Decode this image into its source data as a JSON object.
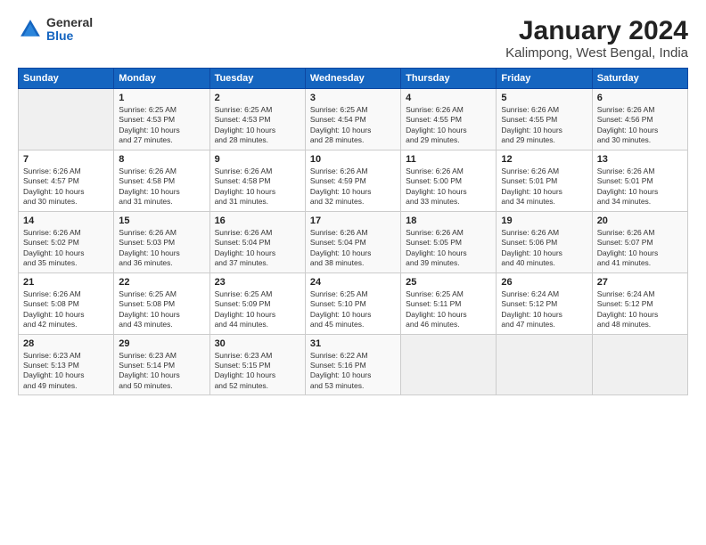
{
  "logo": {
    "general": "General",
    "blue": "Blue"
  },
  "title": "January 2024",
  "subtitle": "Kalimpong, West Bengal, India",
  "days_header": [
    "Sunday",
    "Monday",
    "Tuesday",
    "Wednesday",
    "Thursday",
    "Friday",
    "Saturday"
  ],
  "weeks": [
    [
      {
        "num": "",
        "info": ""
      },
      {
        "num": "1",
        "info": "Sunrise: 6:25 AM\nSunset: 4:53 PM\nDaylight: 10 hours\nand 27 minutes."
      },
      {
        "num": "2",
        "info": "Sunrise: 6:25 AM\nSunset: 4:53 PM\nDaylight: 10 hours\nand 28 minutes."
      },
      {
        "num": "3",
        "info": "Sunrise: 6:25 AM\nSunset: 4:54 PM\nDaylight: 10 hours\nand 28 minutes."
      },
      {
        "num": "4",
        "info": "Sunrise: 6:26 AM\nSunset: 4:55 PM\nDaylight: 10 hours\nand 29 minutes."
      },
      {
        "num": "5",
        "info": "Sunrise: 6:26 AM\nSunset: 4:55 PM\nDaylight: 10 hours\nand 29 minutes."
      },
      {
        "num": "6",
        "info": "Sunrise: 6:26 AM\nSunset: 4:56 PM\nDaylight: 10 hours\nand 30 minutes."
      }
    ],
    [
      {
        "num": "7",
        "info": "Sunrise: 6:26 AM\nSunset: 4:57 PM\nDaylight: 10 hours\nand 30 minutes."
      },
      {
        "num": "8",
        "info": "Sunrise: 6:26 AM\nSunset: 4:58 PM\nDaylight: 10 hours\nand 31 minutes."
      },
      {
        "num": "9",
        "info": "Sunrise: 6:26 AM\nSunset: 4:58 PM\nDaylight: 10 hours\nand 31 minutes."
      },
      {
        "num": "10",
        "info": "Sunrise: 6:26 AM\nSunset: 4:59 PM\nDaylight: 10 hours\nand 32 minutes."
      },
      {
        "num": "11",
        "info": "Sunrise: 6:26 AM\nSunset: 5:00 PM\nDaylight: 10 hours\nand 33 minutes."
      },
      {
        "num": "12",
        "info": "Sunrise: 6:26 AM\nSunset: 5:01 PM\nDaylight: 10 hours\nand 34 minutes."
      },
      {
        "num": "13",
        "info": "Sunrise: 6:26 AM\nSunset: 5:01 PM\nDaylight: 10 hours\nand 34 minutes."
      }
    ],
    [
      {
        "num": "14",
        "info": "Sunrise: 6:26 AM\nSunset: 5:02 PM\nDaylight: 10 hours\nand 35 minutes."
      },
      {
        "num": "15",
        "info": "Sunrise: 6:26 AM\nSunset: 5:03 PM\nDaylight: 10 hours\nand 36 minutes."
      },
      {
        "num": "16",
        "info": "Sunrise: 6:26 AM\nSunset: 5:04 PM\nDaylight: 10 hours\nand 37 minutes."
      },
      {
        "num": "17",
        "info": "Sunrise: 6:26 AM\nSunset: 5:04 PM\nDaylight: 10 hours\nand 38 minutes."
      },
      {
        "num": "18",
        "info": "Sunrise: 6:26 AM\nSunset: 5:05 PM\nDaylight: 10 hours\nand 39 minutes."
      },
      {
        "num": "19",
        "info": "Sunrise: 6:26 AM\nSunset: 5:06 PM\nDaylight: 10 hours\nand 40 minutes."
      },
      {
        "num": "20",
        "info": "Sunrise: 6:26 AM\nSunset: 5:07 PM\nDaylight: 10 hours\nand 41 minutes."
      }
    ],
    [
      {
        "num": "21",
        "info": "Sunrise: 6:26 AM\nSunset: 5:08 PM\nDaylight: 10 hours\nand 42 minutes."
      },
      {
        "num": "22",
        "info": "Sunrise: 6:25 AM\nSunset: 5:08 PM\nDaylight: 10 hours\nand 43 minutes."
      },
      {
        "num": "23",
        "info": "Sunrise: 6:25 AM\nSunset: 5:09 PM\nDaylight: 10 hours\nand 44 minutes."
      },
      {
        "num": "24",
        "info": "Sunrise: 6:25 AM\nSunset: 5:10 PM\nDaylight: 10 hours\nand 45 minutes."
      },
      {
        "num": "25",
        "info": "Sunrise: 6:25 AM\nSunset: 5:11 PM\nDaylight: 10 hours\nand 46 minutes."
      },
      {
        "num": "26",
        "info": "Sunrise: 6:24 AM\nSunset: 5:12 PM\nDaylight: 10 hours\nand 47 minutes."
      },
      {
        "num": "27",
        "info": "Sunrise: 6:24 AM\nSunset: 5:12 PM\nDaylight: 10 hours\nand 48 minutes."
      }
    ],
    [
      {
        "num": "28",
        "info": "Sunrise: 6:23 AM\nSunset: 5:13 PM\nDaylight: 10 hours\nand 49 minutes."
      },
      {
        "num": "29",
        "info": "Sunrise: 6:23 AM\nSunset: 5:14 PM\nDaylight: 10 hours\nand 50 minutes."
      },
      {
        "num": "30",
        "info": "Sunrise: 6:23 AM\nSunset: 5:15 PM\nDaylight: 10 hours\nand 52 minutes."
      },
      {
        "num": "31",
        "info": "Sunrise: 6:22 AM\nSunset: 5:16 PM\nDaylight: 10 hours\nand 53 minutes."
      },
      {
        "num": "",
        "info": ""
      },
      {
        "num": "",
        "info": ""
      },
      {
        "num": "",
        "info": ""
      }
    ]
  ]
}
